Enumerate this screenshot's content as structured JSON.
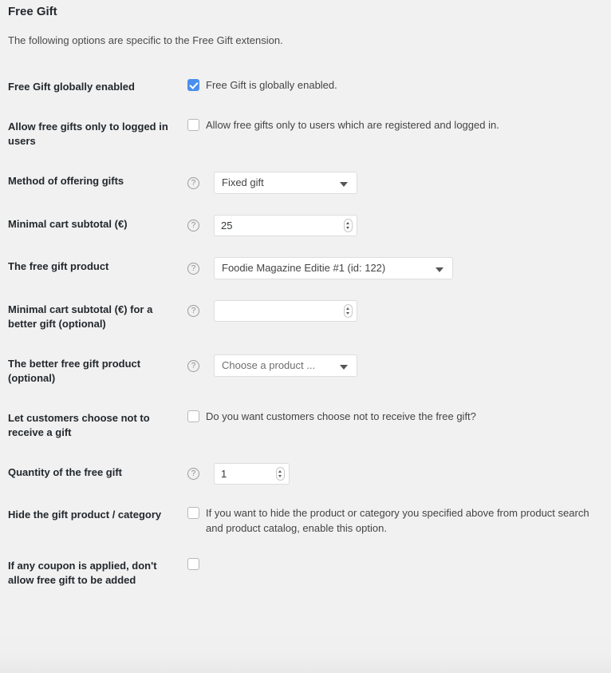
{
  "section": {
    "title": "Free Gift",
    "description": "The following options are specific to the Free Gift extension."
  },
  "icons": {
    "help": "?",
    "help_icon_name": "help-circle-icon",
    "dropdown_icon_name": "chevron-down-icon",
    "spinner_icon_name": "number-spinner-icon"
  },
  "colors": {
    "checkbox_checked": "#4a8ff0",
    "page_background": "#f1f1f1",
    "label_text": "#23282d",
    "field_border": "#dddddd"
  },
  "rows": [
    {
      "label": "Free Gift globally enabled",
      "type": "checkbox",
      "checked": true,
      "checkbox_label": "Free Gift is globally enabled.",
      "has_help": false
    },
    {
      "label": "Allow free gifts only to logged in users",
      "type": "checkbox",
      "checked": false,
      "checkbox_label": "Allow free gifts only to users which are registered and logged in.",
      "has_help": false
    },
    {
      "label": "Method of offering gifts",
      "type": "select",
      "value": "Fixed gift",
      "is_placeholder": false,
      "has_help": true
    },
    {
      "label": "Minimal cart subtotal (€)",
      "type": "number",
      "value": "25",
      "has_help": true
    },
    {
      "label": "The free gift product",
      "type": "select",
      "value": "Foodie Magazine Editie #1 (id: 122)",
      "is_placeholder": false,
      "has_help": true
    },
    {
      "label": "Minimal cart subtotal (€) for a better gift (optional)",
      "type": "number",
      "value": "",
      "has_help": true
    },
    {
      "label": "The better free gift product (optional)",
      "type": "select",
      "value": "Choose a product ...",
      "is_placeholder": true,
      "has_help": true
    },
    {
      "label": "Let customers choose not to receive a gift",
      "type": "checkbox",
      "checked": false,
      "checkbox_label": "Do you want customers choose not to receive the free gift?",
      "has_help": false
    },
    {
      "label": "Quantity of the free gift",
      "type": "number",
      "value": "1",
      "has_help": true
    },
    {
      "label": "Hide the gift product / category",
      "type": "checkbox",
      "checked": false,
      "checkbox_label": "If you want to hide the product or category you specified above from product search and product catalog, enable this option.",
      "has_help": false
    },
    {
      "label": "If any coupon is applied, don't allow free gift to be added",
      "type": "checkbox",
      "checked": false,
      "checkbox_label": "",
      "has_help": false
    }
  ]
}
